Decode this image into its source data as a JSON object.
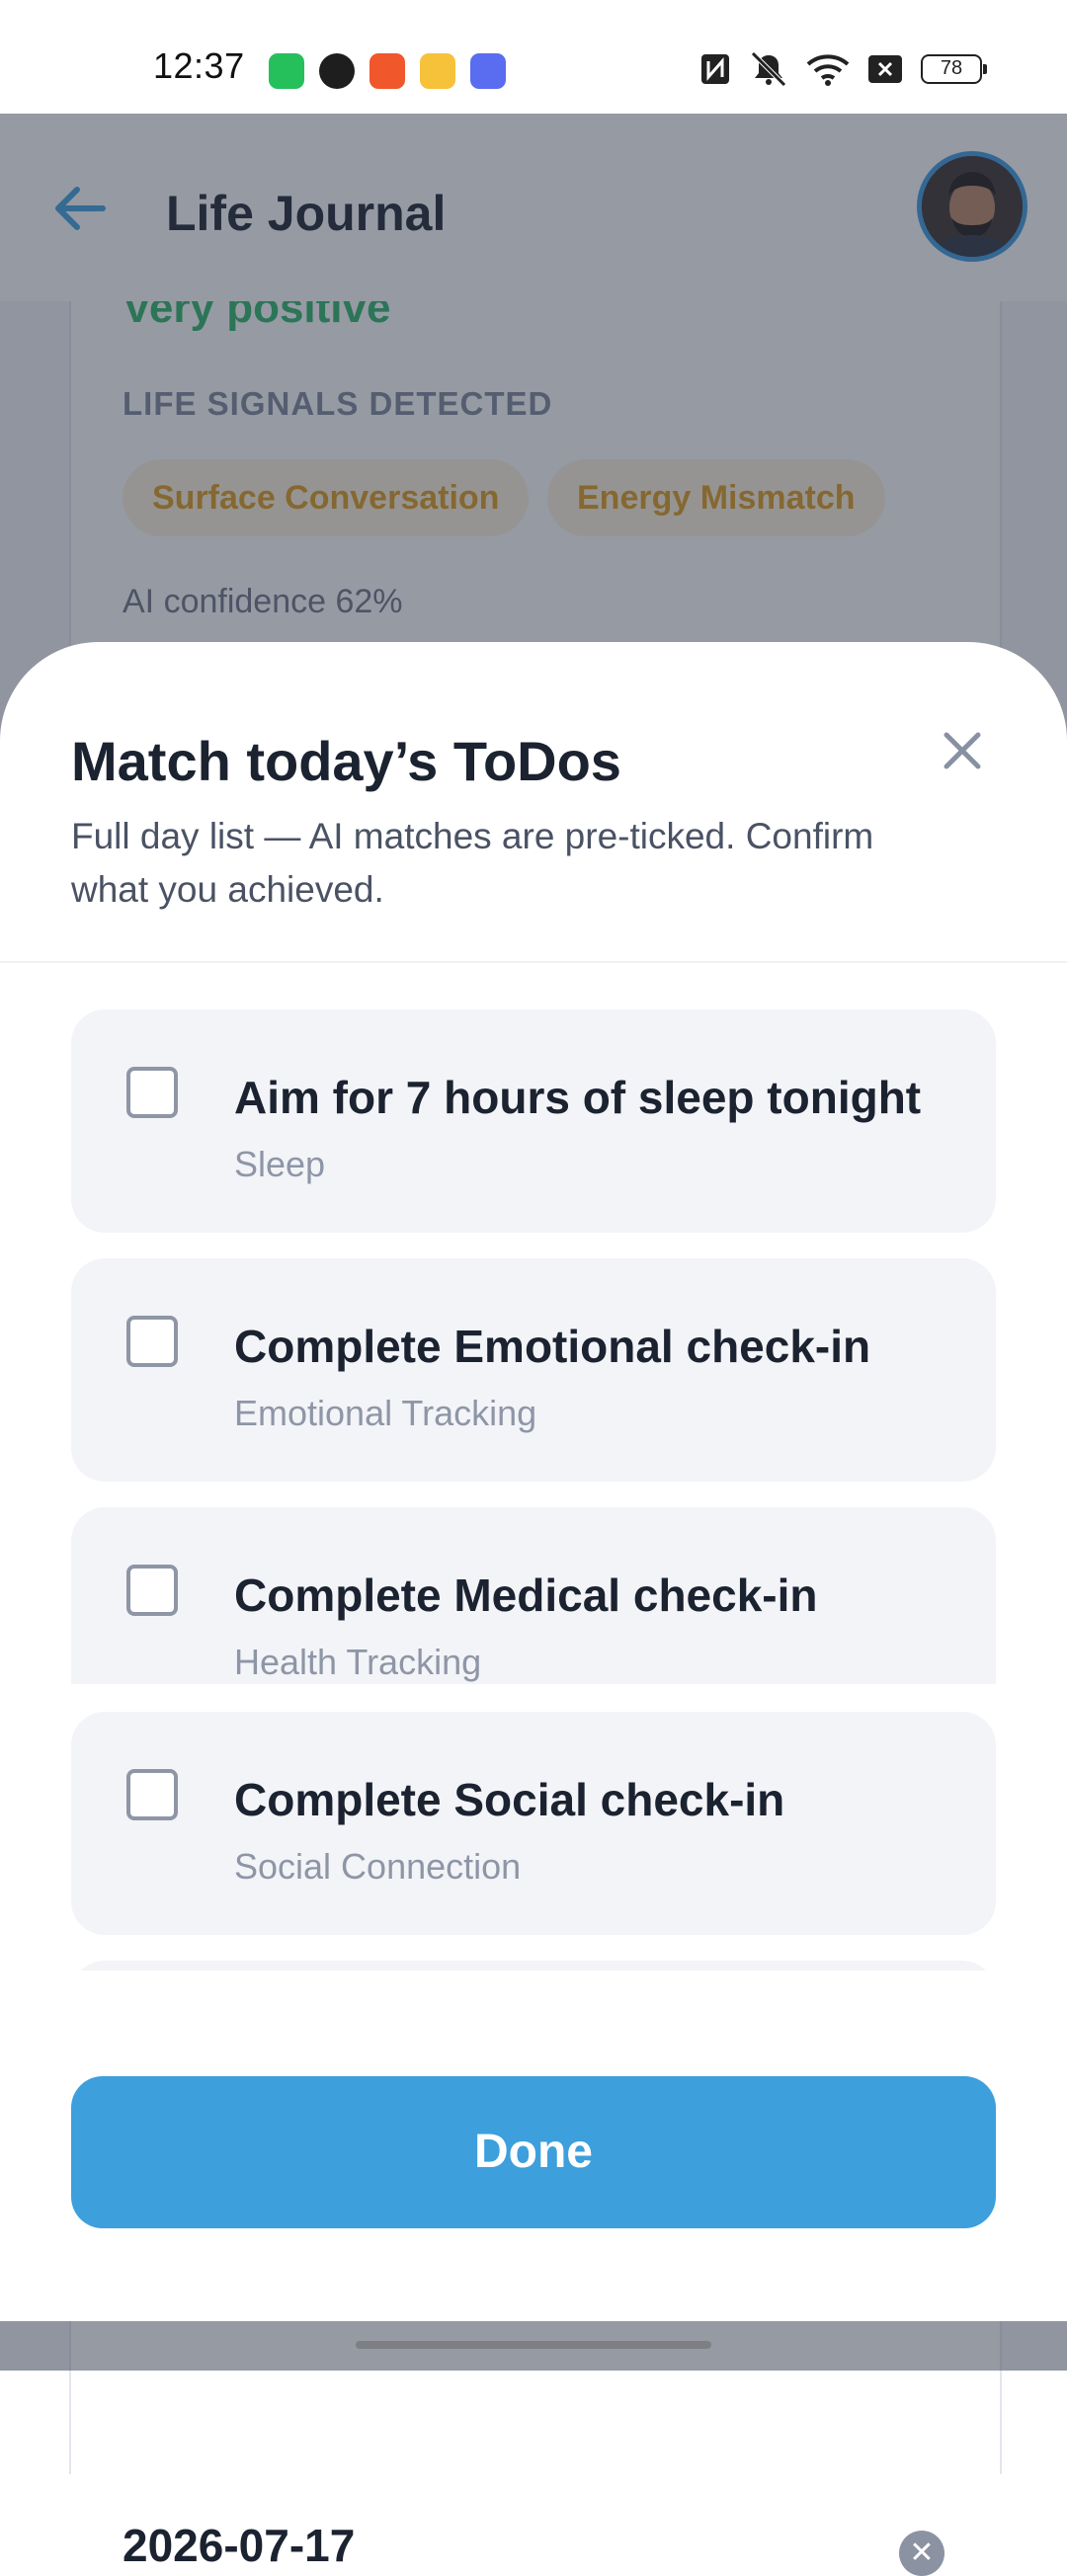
{
  "status_bar": {
    "time": "12:37",
    "battery": "78",
    "app_icon_colors": [
      "#25c05b",
      "#1e1e1e",
      "#f0572b",
      "#f6c23a",
      "#5a6cf0"
    ]
  },
  "header": {
    "title": "Life Journal"
  },
  "background_card": {
    "sentiment": "Very positive",
    "signals_heading": "LIFE SIGNALS DETECTED",
    "chips": [
      "Surface Conversation",
      "Energy Mismatch"
    ],
    "confidence": "AI confidence 62%",
    "next_date": "2026-07-17"
  },
  "sheet": {
    "title": "Match today’s ToDos",
    "subtitle": "Full day list — AI matches are pre-ticked. Confirm what you achieved.",
    "todos": [
      {
        "title": "Aim for 7 hours of sleep tonight",
        "category": "Sleep",
        "checked": false
      },
      {
        "title": "Complete Emotional check-in",
        "category": "Emotional Tracking",
        "checked": false
      },
      {
        "title": "Complete Medical check-in",
        "category": "Health Tracking",
        "checked": false
      },
      {
        "title": "Complete Social check-in",
        "category": "Social Connection",
        "checked": false
      }
    ],
    "done_label": "Done"
  },
  "colors": {
    "accent": "#3d9fdc",
    "sentiment_green": "#2bb566",
    "chip_text": "#dd9a1a"
  }
}
